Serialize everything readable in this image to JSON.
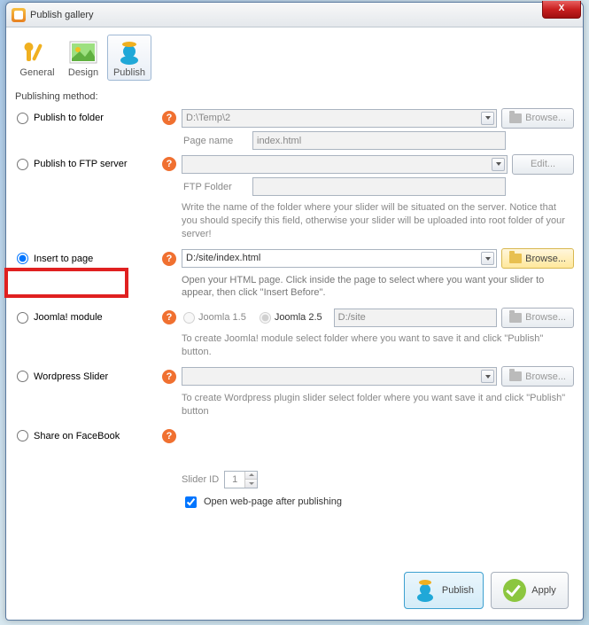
{
  "window": {
    "title": "Publish gallery"
  },
  "tabs": {
    "general": "General",
    "design": "Design",
    "publish": "Publish"
  },
  "section_label": "Publishing method:",
  "methods": {
    "folder": {
      "label": "Publish to folder",
      "path": "D:\\Temp\\2",
      "browse": "Browse...",
      "page_name_label": "Page name",
      "page_name_value": "index.html"
    },
    "ftp": {
      "label": "Publish to FTP server",
      "edit": "Edit...",
      "ftp_folder_label": "FTP Folder",
      "hint": "Write the name of the folder where your slider will be situated on the server. Notice that you should specify this field, otherwise your slider will be uploaded into root folder of your server!"
    },
    "insert": {
      "label": "Insert to page",
      "path": "D:/site/index.html",
      "browse": "Browse...",
      "hint": "Open your HTML page. Click inside the page to select where you want your slider to appear, then click \"Insert Before\"."
    },
    "joomla": {
      "label": "Joomla! module",
      "opt15": "Joomla 1.5",
      "opt25": "Joomla 2.5",
      "path": "D:/site",
      "browse": "Browse...",
      "hint": "To create Joomla! module select folder where you want to save it and click \"Publish\" button."
    },
    "wordpress": {
      "label": "Wordpress Slider",
      "browse": "Browse...",
      "hint": "To create Wordpress plugin slider select folder where you want save it and click \"Publish\" button"
    },
    "facebook": {
      "label": "Share on FaceBook"
    }
  },
  "slider_id": {
    "label": "Slider ID",
    "value": "1"
  },
  "open_after": {
    "label": "Open web-page after publishing"
  },
  "footer": {
    "publish": "Publish",
    "apply": "Apply"
  }
}
